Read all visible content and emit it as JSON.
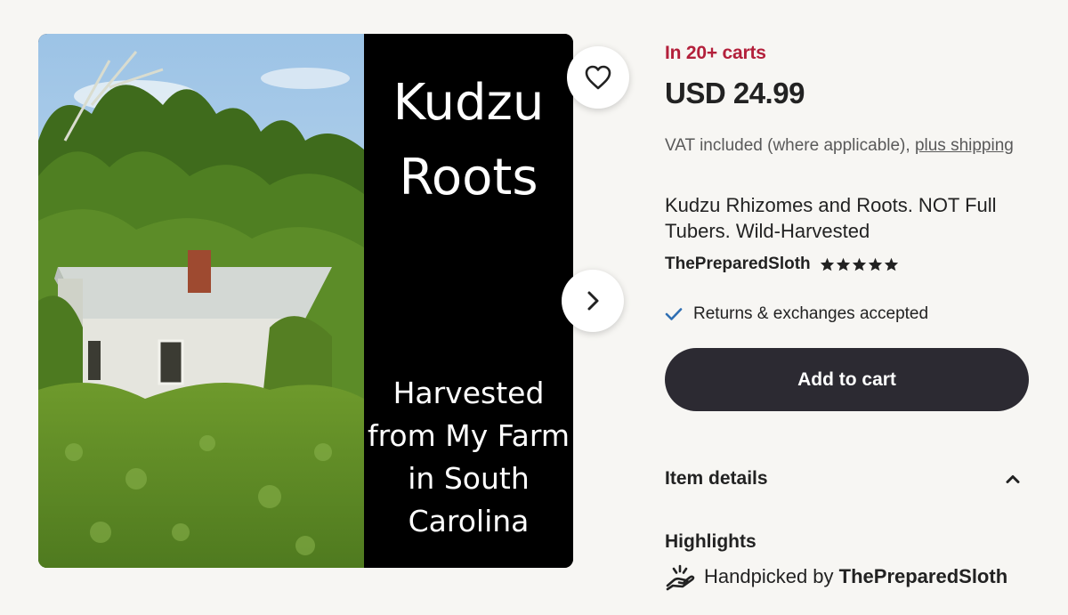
{
  "gallery": {
    "panel_title": "Kudzu\nRoots",
    "panel_subtitle": "Harvested\nfrom My Farm\nin South\nCarolina",
    "favorite_icon": "heart-outline-icon",
    "next_icon": "chevron-right-icon"
  },
  "listing": {
    "carts_badge": "In 20+ carts",
    "price": "USD 24.99",
    "vat_text": "VAT included (where applicable), ",
    "vat_link": "plus shipping",
    "title": "Kudzu Rhizomes and Roots. NOT Full Tubers. Wild-Harvested",
    "shop_name": "ThePreparedSloth",
    "rating_stars": 5,
    "returns_text": "Returns & exchanges accepted",
    "add_to_cart_label": "Add to cart",
    "item_details_label": "Item details",
    "highlights_label": "Highlights",
    "handpicked_prefix": "Handpicked by ",
    "handpicked_shop": "ThePreparedSloth"
  },
  "colors": {
    "accent_red": "#b3203b",
    "cart_button": "#2c2a32",
    "check_blue": "#2f6fb3",
    "background": "#f7f6f3"
  }
}
